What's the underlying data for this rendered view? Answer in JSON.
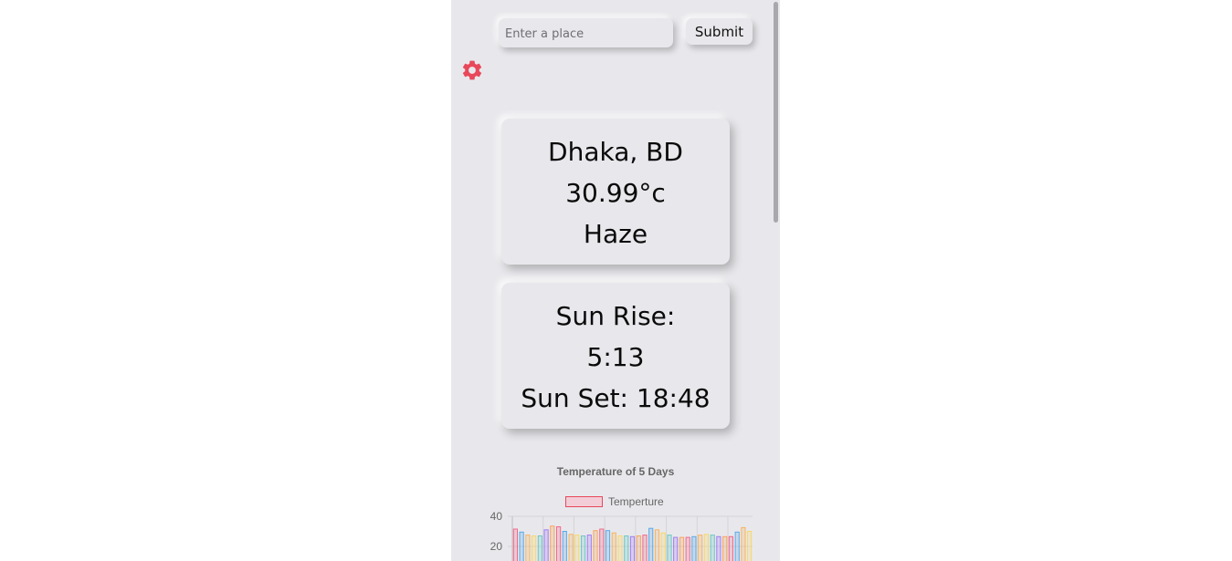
{
  "search": {
    "placeholder": "Enter a place",
    "value": ""
  },
  "submit_label": "Submit",
  "settings_icon": "gear-icon",
  "weather": {
    "location": "Dhaka, BD",
    "temperature": "30.99°c",
    "condition": "Haze"
  },
  "sun": {
    "rise_label": "Sun Rise:",
    "rise_time": "5:13",
    "set_text": "Sun Set: 18:48"
  },
  "colors": {
    "background": "#e8e8ec",
    "accent": "#e8485a",
    "text": "#0a0a0a"
  },
  "chart_data": {
    "type": "bar",
    "title": "Temperature of 5 Days",
    "legend": {
      "label": "Temperture",
      "position": "top"
    },
    "ylim": [
      0,
      40
    ],
    "yticks": [
      "40",
      "20"
    ],
    "grid": true,
    "values": [
      31.5,
      29.5,
      27.5,
      27.0,
      27.0,
      31.0,
      33.5,
      33.0,
      30.0,
      28.0,
      27.5,
      27.0,
      27.5,
      30.5,
      31.5,
      30.5,
      29.0,
      27.0,
      27.0,
      26.5,
      27.0,
      27.5,
      32.0,
      31.0,
      29.0,
      27.5,
      26.0,
      26.0,
      26.0,
      26.5,
      27.5,
      28.0,
      27.5,
      26.5,
      26.5,
      26.5,
      29.5,
      32.5,
      30.0
    ],
    "bar_colors": [
      "#f06a8a",
      "#5aa9e6",
      "#f5b461",
      "#f7d86b",
      "#6cc9c4",
      "#a27cf0",
      "#f8a55d"
    ]
  }
}
